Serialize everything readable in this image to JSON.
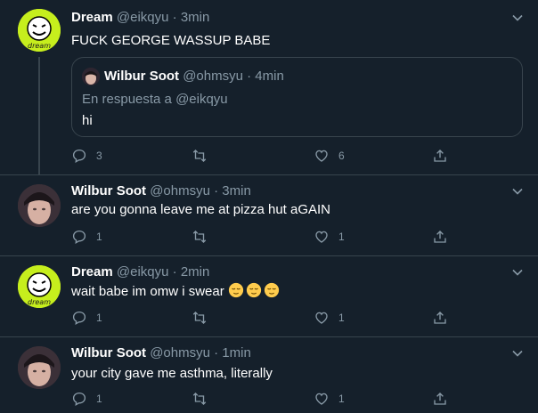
{
  "tweets": [
    {
      "name": "Dream",
      "handle": "@eikqyu",
      "time": "3min",
      "text": "FUCK GEORGE WASSUP BABE",
      "avatar_label": "dream",
      "quote": {
        "name": "Wilbur Soot",
        "handle": "@ohmsyu",
        "time": "4min",
        "reply_to": "En respuesta a @eikqyu",
        "text": "hi"
      },
      "replies": "3",
      "likes": "6"
    },
    {
      "name": "Wilbur Soot",
      "handle": "@ohmsyu",
      "time": "3min",
      "text": "are you gonna leave me at pizza hut aGAIN",
      "replies": "1",
      "likes": "1"
    },
    {
      "name": "Dream",
      "handle": "@eikqyu",
      "time": "2min",
      "text": "wait babe im omw i swear",
      "avatar_label": "dream",
      "emoji": "relieved-face",
      "replies": "1",
      "likes": "1"
    },
    {
      "name": "Wilbur Soot",
      "handle": "@ohmsyu",
      "time": "1min",
      "text": "your city gave me asthma, literally",
      "replies": "1",
      "likes": "1"
    }
  ],
  "separator": " · ",
  "colors": {
    "background": "#15202b",
    "secondary_text": "#8899a6",
    "border": "#38444d",
    "dream_green": "#c6ee1d"
  }
}
